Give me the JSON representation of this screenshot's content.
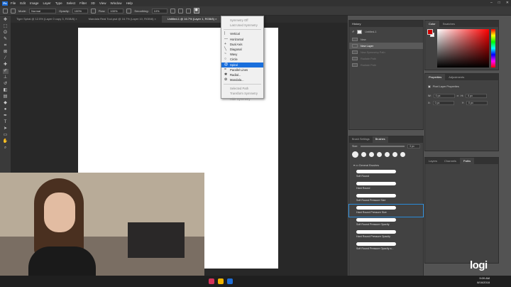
{
  "menubar": {
    "logo": "Ps",
    "items": [
      "File",
      "Edit",
      "Image",
      "Layer",
      "Type",
      "Select",
      "Filter",
      "3D",
      "View",
      "Window",
      "Help"
    ],
    "window_controls": [
      "–",
      "□",
      "✕"
    ]
  },
  "options": {
    "mode_label": "Mode:",
    "mode_value": "Normal",
    "opacity_label": "Opacity:",
    "opacity_value": "100%",
    "flow_label": "Flow:",
    "flow_value": "100%",
    "smoothing_label": "Smoothing:",
    "smoothing_value": "10%",
    "symmetry_icon": "butterfly-icon"
  },
  "doc_tabs": [
    "Tiger Spiral @ 12.5% (Layer 0 copy 3, RGB/8) ×",
    "Mandala Real Tool.psd @ 16.7% (Layer 10, RGB/8) ×",
    "Untitled-1 @ 16.7% (Layer 1, RGB/8) ×"
  ],
  "symmetry_menu": {
    "items": [
      {
        "label": "Symmetry Off",
        "glyph": "",
        "state": "dim"
      },
      {
        "label": "Last Used Symmetry",
        "glyph": "",
        "state": "dim"
      },
      {
        "label": "Vertical",
        "glyph": "|",
        "state": "normal"
      },
      {
        "label": "Horizontal",
        "glyph": "—",
        "state": "normal"
      },
      {
        "label": "Dual Axis",
        "glyph": "+",
        "state": "normal"
      },
      {
        "label": "Diagonal",
        "glyph": "╲",
        "state": "normal"
      },
      {
        "label": "Wavy",
        "glyph": "~",
        "state": "normal"
      },
      {
        "label": "Circle",
        "glyph": "○",
        "state": "normal"
      },
      {
        "label": "Spiral",
        "glyph": "@",
        "state": "highlight"
      },
      {
        "label": "Parallel Lines",
        "glyph": "=",
        "state": "normal"
      },
      {
        "label": "Radial...",
        "glyph": "✱",
        "state": "normal"
      },
      {
        "label": "Mandala...",
        "glyph": "✿",
        "state": "normal"
      }
    ],
    "footer": [
      "Selected Path",
      "Transform Symmetry",
      "Hide Symmetry"
    ]
  },
  "history": {
    "title": "History",
    "snapshot": "Untitled-1",
    "rows": [
      {
        "label": "New",
        "state": "normal"
      },
      {
        "label": "New Layer",
        "state": "selected"
      },
      {
        "label": "New Symmetry Path",
        "state": "dim"
      },
      {
        "label": "Radiate Path",
        "state": "dim"
      },
      {
        "label": "Radiate Path",
        "state": "dim"
      }
    ]
  },
  "brushes": {
    "tabs": [
      "Brush Settings",
      "Brushes"
    ],
    "size_label": "Size:",
    "size_value": "3 px",
    "group": "General Brushes",
    "items": [
      "Soft Round",
      "Hard Round",
      "Soft Round Pressure Size",
      "Hard Round Pressure Size",
      "Soft Round Pressure Opacity",
      "Hard Round Pressure Opacity",
      "Soft Round Pressure Opacity a..."
    ]
  },
  "color": {
    "tabs": [
      "Color",
      "Swatches"
    ],
    "foreground": "#cc0000",
    "background": "#ffffff"
  },
  "properties": {
    "tabs": [
      "Properties",
      "Adjustments"
    ],
    "title": "Pixel Layer Properties",
    "w_label": "W:",
    "w_value": "0 px",
    "h_label": "H:",
    "h_value": "0 px",
    "x_label": "X:",
    "x_value": "0 px",
    "y_label": "Y:",
    "y_value": "0 px"
  },
  "layers": {
    "tabs": [
      "Layers",
      "Channels",
      "Paths"
    ]
  },
  "tray": {
    "time": "9:09 AM",
    "date": "8/16/2018"
  },
  "watermark": "logi"
}
